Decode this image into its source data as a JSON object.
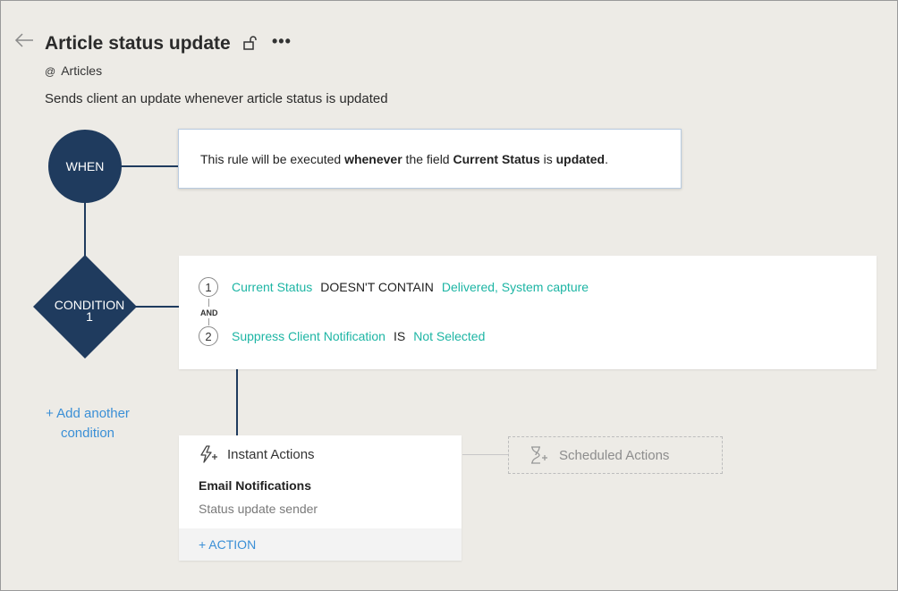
{
  "header": {
    "title": "Article status update",
    "module_prefix": "@",
    "module": "Articles",
    "description": "Sends client an update whenever article status is updated",
    "more_label": "•••"
  },
  "when": {
    "label": "WHEN",
    "text_1": "This rule will be executed ",
    "bold_1": "whenever",
    "text_2": " the field ",
    "bold_2": "Current Status",
    "text_3": " is ",
    "bold_3": "updated",
    "text_4": "."
  },
  "condition": {
    "label_line1": "CONDITION",
    "label_line2": "1",
    "and_label": "AND",
    "criteria": [
      {
        "num": "1",
        "field": "Current Status",
        "operator": "DOESN'T CONTAIN",
        "value": "Delivered, System capture"
      },
      {
        "num": "2",
        "field": "Suppress Client Notification",
        "operator": "IS",
        "value": "Not Selected"
      }
    ]
  },
  "add_condition": {
    "line1": "+ Add another",
    "line2": "condition"
  },
  "instant_actions": {
    "title": "Instant Actions",
    "email_title": "Email Notifications",
    "email_item": "Status update sender",
    "add_action": "+ ACTION"
  },
  "scheduled_actions": {
    "title": "Scheduled Actions"
  },
  "colors": {
    "navy": "#1f3b5e",
    "teal": "#1db5a4",
    "link_blue": "#3a8fd6",
    "background": "#edebe6"
  },
  "icons": {
    "back": "arrow-left-icon",
    "lock": "unlock-icon",
    "instant": "lightning-plus-icon",
    "scheduled": "hourglass-plus-icon"
  }
}
